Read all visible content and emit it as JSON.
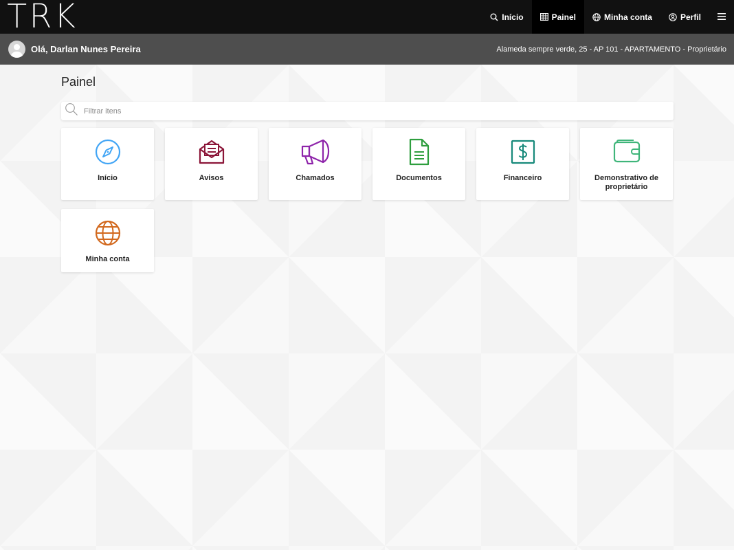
{
  "brand": {
    "logo_text": "TRK"
  },
  "nav": {
    "items": [
      {
        "label": "Início",
        "icon": "search-icon"
      },
      {
        "label": "Painel",
        "icon": "grid-icon",
        "active": true
      },
      {
        "label": "Minha conta",
        "icon": "globe-icon"
      },
      {
        "label": "Perfil",
        "icon": "user-circle-icon"
      }
    ],
    "menu_icon": "hamburger-menu-icon"
  },
  "user": {
    "greeting": "Olá, Darlan Nunes Pereira",
    "address": "Alameda sempre verde, 25 - AP 101 - APARTAMENTO - Proprietário"
  },
  "page": {
    "title": "Painel"
  },
  "filter": {
    "placeholder": "Filtrar itens",
    "value": ""
  },
  "tiles": [
    {
      "label": "Início",
      "icon": "compass-icon",
      "color": "#42a5f5"
    },
    {
      "label": "Avisos",
      "icon": "mail-open-icon",
      "color": "#8b1538"
    },
    {
      "label": "Chamados",
      "icon": "megaphone-icon",
      "color": "#8e24aa"
    },
    {
      "label": "Documentos",
      "icon": "document-icon",
      "color": "#2e9e3e"
    },
    {
      "label": "Financeiro",
      "icon": "dollar-icon",
      "color": "#16897a"
    },
    {
      "label": "Demonstrativo de proprietário",
      "icon": "wallet-icon",
      "color": "#3fb57a"
    },
    {
      "label": "Minha conta",
      "icon": "globe-icon",
      "color": "#d2691e"
    }
  ],
  "colors": {
    "topbar": "#111111",
    "userbar": "#4e4e4e",
    "active_nav": "#000000"
  }
}
